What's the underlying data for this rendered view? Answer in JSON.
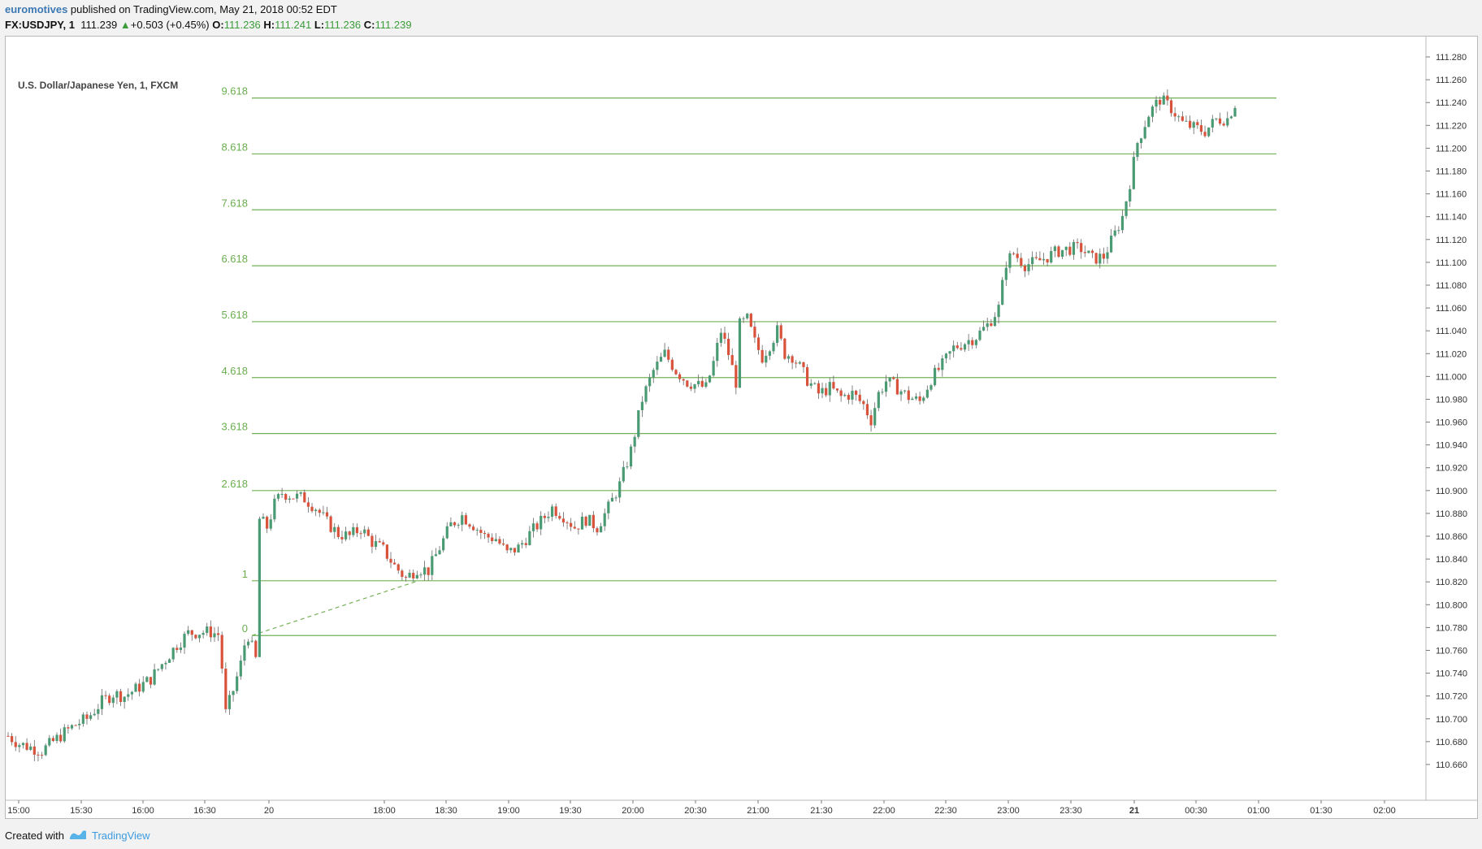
{
  "header": {
    "author": "euromotives",
    "published_text": " published on TradingView.com, May 21, 2018 00:52 EDT",
    "symbol": "FX:USDJPY, 1",
    "last": "111.239",
    "change": "+0.503 (+0.45%)",
    "o_label": "O:",
    "o_val": "111.236",
    "h_label": "H:",
    "h_val": "111.241",
    "l_label": "L:",
    "l_val": "111.236",
    "c_label": "C:",
    "c_val": "111.239"
  },
  "legend_title": "U.S. Dollar/Japanese Yen, 1, FXCM",
  "footer": {
    "created_with": "Created with",
    "brand": "TradingView"
  },
  "colors": {
    "up": "#4a9b74",
    "down": "#d9523b",
    "fib": "#74b057",
    "wick": "#666666",
    "trend": "#74b057"
  },
  "chart_data": {
    "type": "candlestick",
    "y_axis": {
      "min": 110.65,
      "max": 111.29,
      "ticks": [
        111.28,
        111.26,
        111.24,
        111.22,
        111.2,
        111.18,
        111.16,
        111.14,
        111.12,
        111.1,
        111.08,
        111.06,
        111.04,
        111.02,
        111.0,
        110.98,
        110.96,
        110.94,
        110.92,
        110.9,
        110.88,
        110.86,
        110.84,
        110.82,
        110.8,
        110.78,
        110.76,
        110.74,
        110.72,
        110.7,
        110.68,
        110.66
      ],
      "tick_labels": [
        "111.280",
        "111.260",
        "111.240",
        "111.220",
        "111.200",
        "111.180",
        "111.160",
        "111.140",
        "111.120",
        "111.100",
        "111.080",
        "111.060",
        "111.040",
        "111.020",
        "111.000",
        "110.980",
        "110.960",
        "110.940",
        "110.920",
        "110.900",
        "110.880",
        "110.860",
        "110.840",
        "110.820",
        "110.800",
        "110.780",
        "110.760",
        "110.740",
        "110.720",
        "110.700",
        "110.680",
        "110.660"
      ]
    },
    "x_axis": {
      "labels": [
        "15:00",
        "15:30",
        "16:00",
        "16:30",
        "20",
        "18:00",
        "18:30",
        "19:00",
        "19:30",
        "20:00",
        "20:30",
        "21:00",
        "21:30",
        "22:00",
        "22:30",
        "23:00",
        "23:30",
        "21",
        "00:30",
        "01:00",
        "01:30",
        "02:00"
      ],
      "bold": [
        false,
        false,
        false,
        false,
        false,
        false,
        false,
        false,
        false,
        false,
        false,
        false,
        false,
        false,
        false,
        false,
        false,
        true,
        false,
        false,
        false,
        false
      ]
    },
    "fib_levels": [
      {
        "label": "0",
        "price": 110.773
      },
      {
        "label": "1",
        "price": 110.821
      },
      {
        "label": "2.618",
        "price": 110.9
      },
      {
        "label": "3.618",
        "price": 110.95
      },
      {
        "label": "4.618",
        "price": 110.999
      },
      {
        "label": "5.618",
        "price": 111.048
      },
      {
        "label": "6.618",
        "price": 111.097
      },
      {
        "label": "7.618",
        "price": 111.146
      },
      {
        "label": "8.618",
        "price": 111.195
      },
      {
        "label": "9.618",
        "price": 111.244
      }
    ],
    "price_path": [
      [
        0,
        110.685
      ],
      [
        3,
        110.678
      ],
      [
        6,
        110.675
      ],
      [
        9,
        110.672
      ],
      [
        12,
        110.68
      ],
      [
        15,
        110.688
      ],
      [
        18,
        110.695
      ],
      [
        21,
        110.7
      ],
      [
        25,
        110.715
      ],
      [
        28,
        110.722
      ],
      [
        31,
        110.72
      ],
      [
        35,
        110.728
      ],
      [
        38,
        110.735
      ],
      [
        41,
        110.748
      ],
      [
        45,
        110.765
      ],
      [
        48,
        110.775
      ],
      [
        51,
        110.776
      ],
      [
        54,
        110.776
      ],
      [
        56,
        110.774
      ],
      [
        57,
        110.745
      ],
      [
        58,
        110.705
      ],
      [
        60,
        110.725
      ],
      [
        62,
        110.748
      ],
      [
        63,
        110.765
      ],
      [
        64,
        110.773
      ],
      [
        66,
        110.752
      ],
      [
        67,
        110.875
      ],
      [
        69,
        110.868
      ],
      [
        71,
        110.888
      ],
      [
        73,
        110.898
      ],
      [
        76,
        110.895
      ],
      [
        79,
        110.893
      ],
      [
        82,
        110.885
      ],
      [
        85,
        110.872
      ],
      [
        88,
        110.862
      ],
      [
        91,
        110.86
      ],
      [
        94,
        110.867
      ],
      [
        97,
        110.855
      ],
      [
        100,
        110.848
      ],
      [
        103,
        110.834
      ],
      [
        106,
        110.823
      ],
      [
        109,
        110.832
      ],
      [
        112,
        110.83
      ],
      [
        115,
        110.85
      ],
      [
        118,
        110.87
      ],
      [
        121,
        110.878
      ],
      [
        124,
        110.87
      ],
      [
        127,
        110.86
      ],
      [
        130,
        110.858
      ],
      [
        133,
        110.845
      ],
      [
        136,
        110.85
      ],
      [
        139,
        110.862
      ],
      [
        142,
        110.873
      ],
      [
        145,
        110.885
      ],
      [
        148,
        110.878
      ],
      [
        151,
        110.868
      ],
      [
        154,
        110.875
      ],
      [
        157,
        110.868
      ],
      [
        160,
        110.885
      ],
      [
        163,
        110.905
      ],
      [
        166,
        110.935
      ],
      [
        169,
        110.98
      ],
      [
        172,
        111.005
      ],
      [
        175,
        111.02
      ],
      [
        178,
        111.005
      ],
      [
        181,
        110.995
      ],
      [
        184,
        110.992
      ],
      [
        186,
        110.99
      ],
      [
        188,
        111.012
      ],
      [
        190,
        111.04
      ],
      [
        192,
        111.02
      ],
      [
        194,
        110.995
      ],
      [
        195,
        111.045
      ],
      [
        197,
        111.05
      ],
      [
        199,
        111.03
      ],
      [
        201,
        111.017
      ],
      [
        203,
        111.028
      ],
      [
        205,
        111.04
      ],
      [
        207,
        111.02
      ],
      [
        209,
        111.018
      ],
      [
        211,
        111.008
      ],
      [
        213,
        110.997
      ],
      [
        216,
        110.985
      ],
      [
        219,
        110.99
      ],
      [
        222,
        110.982
      ],
      [
        225,
        110.985
      ],
      [
        228,
        110.975
      ],
      [
        230,
        110.962
      ],
      [
        232,
        110.985
      ],
      [
        234,
        110.996
      ],
      [
        237,
        110.99
      ],
      [
        240,
        110.982
      ],
      [
        243,
        110.978
      ],
      [
        246,
        110.998
      ],
      [
        249,
        111.01
      ],
      [
        252,
        111.025
      ],
      [
        255,
        111.03
      ],
      [
        258,
        111.035
      ],
      [
        261,
        111.045
      ],
      [
        264,
        111.06
      ],
      [
        266,
        111.1
      ],
      [
        268,
        111.108
      ],
      [
        271,
        111.098
      ],
      [
        274,
        111.1
      ],
      [
        277,
        111.105
      ],
      [
        280,
        111.11
      ],
      [
        283,
        111.112
      ],
      [
        286,
        111.112
      ],
      [
        289,
        111.103
      ],
      [
        292,
        111.105
      ],
      [
        295,
        111.125
      ],
      [
        297,
        111.14
      ],
      [
        299,
        111.17
      ],
      [
        301,
        111.205
      ],
      [
        304,
        111.23
      ],
      [
        307,
        111.243
      ],
      [
        310,
        111.235
      ],
      [
        313,
        111.222
      ],
      [
        316,
        111.218
      ],
      [
        319,
        111.215
      ],
      [
        322,
        111.225
      ],
      [
        325,
        111.226
      ],
      [
        327,
        111.239
      ]
    ]
  }
}
